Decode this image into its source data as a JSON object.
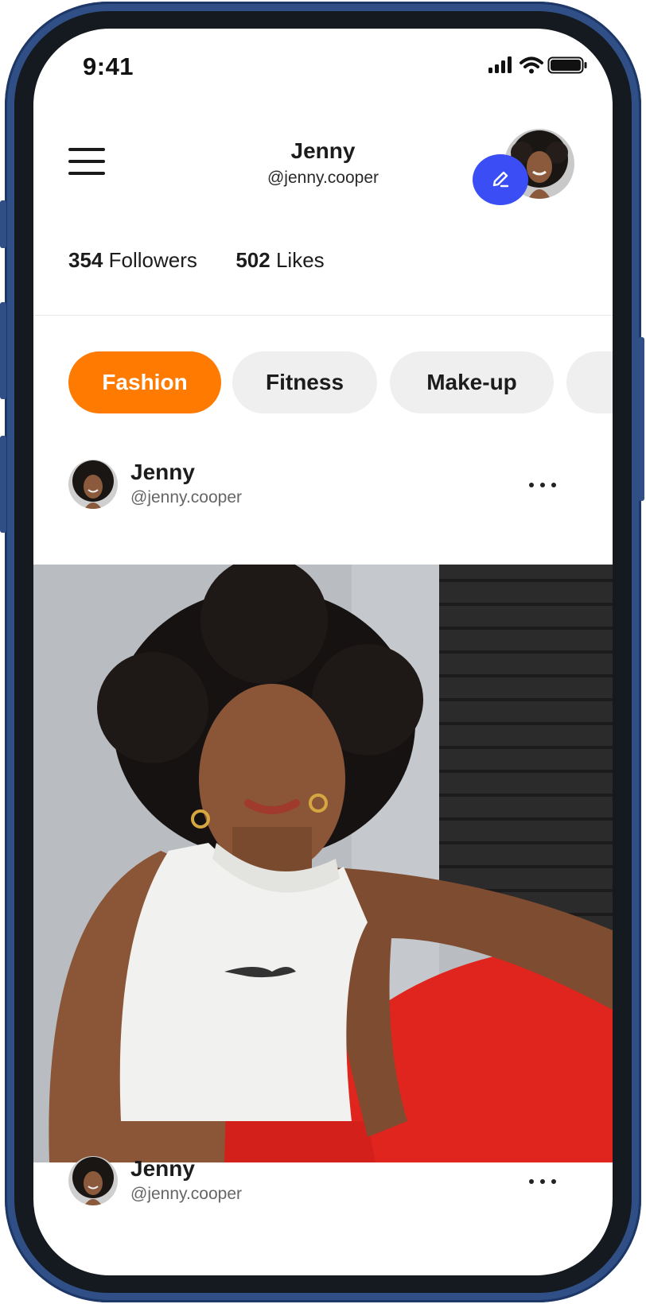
{
  "status_bar": {
    "time": "9:41"
  },
  "header": {
    "name": "Jenny",
    "handle": "@jenny.cooper"
  },
  "stats": {
    "followers_count": "354",
    "followers_label": "Followers",
    "likes_count": "502",
    "likes_label": "Likes"
  },
  "categories": {
    "items": [
      {
        "label": "Fashion",
        "active": true
      },
      {
        "label": "Fitness",
        "active": false
      },
      {
        "label": "Make-up",
        "active": false
      }
    ]
  },
  "posts": [
    {
      "name": "Jenny",
      "handle": "@jenny.cooper"
    },
    {
      "name": "Jenny",
      "handle": "@jenny.cooper"
    }
  ],
  "colors": {
    "accent_orange": "#ff7a00",
    "edit_blue": "#3b4ef5",
    "frame_blue": "#2f4f86"
  },
  "icons": {
    "menu": "hamburger-menu-icon",
    "edit": "pencil-icon",
    "more": "ellipsis-icon",
    "signal": "cellular-signal-icon",
    "wifi": "wifi-icon",
    "battery": "battery-icon"
  }
}
